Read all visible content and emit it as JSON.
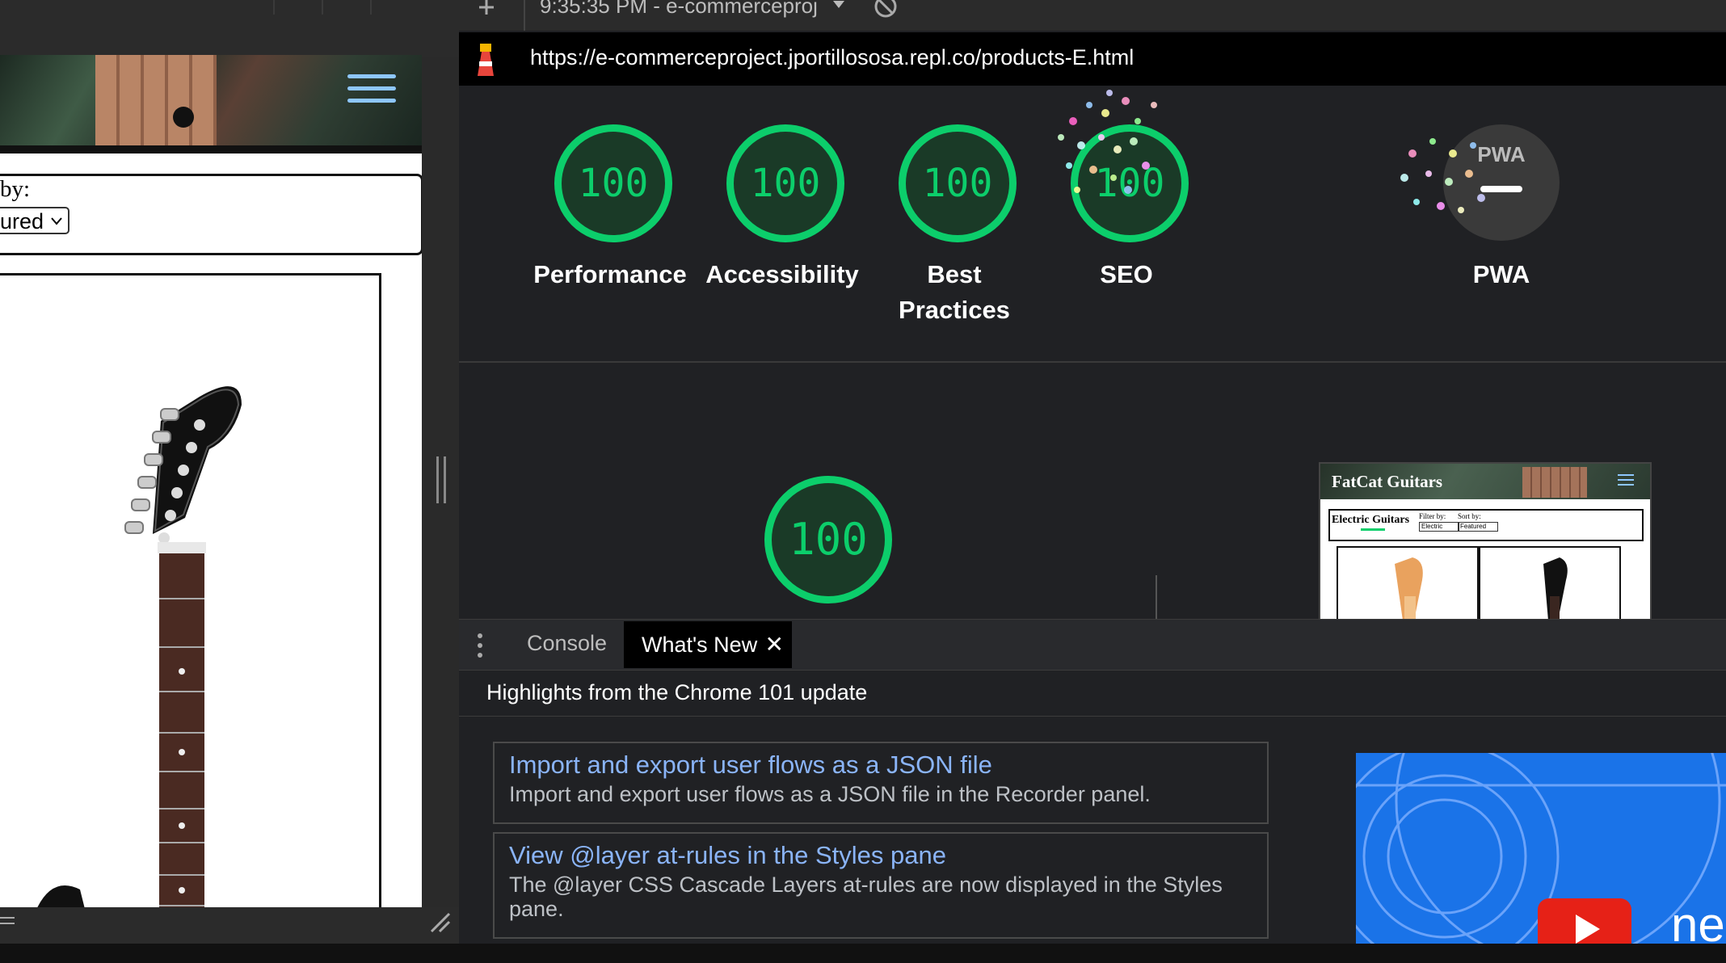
{
  "left_page": {
    "sort_label": "by:",
    "sort_value": "ured"
  },
  "devtools": {
    "tab_title": "9:35:35 PM - e-commerceproj",
    "url": "https://e-commerceproject.jportillososa.repl.co/products-E.html",
    "scores": [
      {
        "label": "Performance",
        "value": "100"
      },
      {
        "label": "Accessibility",
        "value": "100"
      },
      {
        "label": "Best Practices",
        "value": "100"
      },
      {
        "label": "SEO",
        "value": "100"
      },
      {
        "label": "PWA",
        "value": "PWA"
      }
    ],
    "metric_gauge": "100",
    "thumbnail": {
      "brand": "FatCat Guitars",
      "heading": "Electric Guitars",
      "filter_label": "Filter by:",
      "filter_value": "Electric",
      "sort_label": "Sort by:",
      "sort_value": "Featured"
    },
    "drawer": {
      "tabs": [
        "Console",
        "What's New"
      ],
      "close": "✕",
      "highlights": "Highlights from the Chrome 101 update",
      "items": [
        {
          "title": "Import and export user flows as a JSON file",
          "desc": "Import and export user flows as a JSON file in the Recorder panel."
        },
        {
          "title": "View @layer at-rules in the Styles pane",
          "desc": "The @layer CSS Cascade Layers at-rules are now displayed in the Styles pane."
        }
      ],
      "video_text": "ne"
    }
  },
  "colors": {
    "pass_green": "#0cce6b",
    "link_blue": "#8ab4f8",
    "accent_blue": "#1a73e8"
  },
  "icons": [
    "hamburger-menu-icon",
    "lighthouse-icon",
    "new-tab-icon",
    "block-icon",
    "play-icon",
    "kebab-menu-icon",
    "resize-handle-icon"
  ]
}
